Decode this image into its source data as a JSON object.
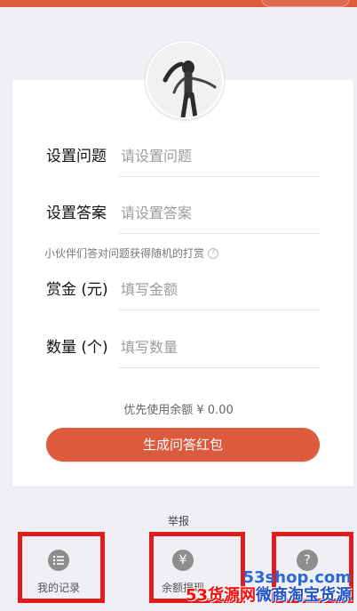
{
  "form": {
    "question_label": "设置问题",
    "question_placeholder": "请设置问题",
    "answer_label": "设置答案",
    "answer_placeholder": "请设置答案",
    "hint": "小伙伴们答对问题获得随机的打赏",
    "hint_icon": "?",
    "reward_label": "赏金 (元)",
    "reward_placeholder": "填写金额",
    "count_label": "数量 (个)",
    "count_placeholder": "填写数量",
    "balance_text": "优先使用余额 ¥ 0.00",
    "submit_label": "生成问答红包"
  },
  "report_link": "举报",
  "bottom_nav": {
    "records": {
      "label": "我的记录",
      "icon": "list-icon"
    },
    "withdraw": {
      "label": "余额提现",
      "icon": "yen-icon",
      "glyph": "¥"
    },
    "help": {
      "label": "",
      "icon": "help-icon",
      "glyph": "?"
    }
  },
  "watermark": {
    "line1": "53shop.com",
    "line2_red": "53货源网",
    "line2_blue": "微商淘宝货源"
  },
  "colors": {
    "accent": "#dc5b3e",
    "highlight_box": "#e01b1b",
    "background": "#efeff4"
  }
}
